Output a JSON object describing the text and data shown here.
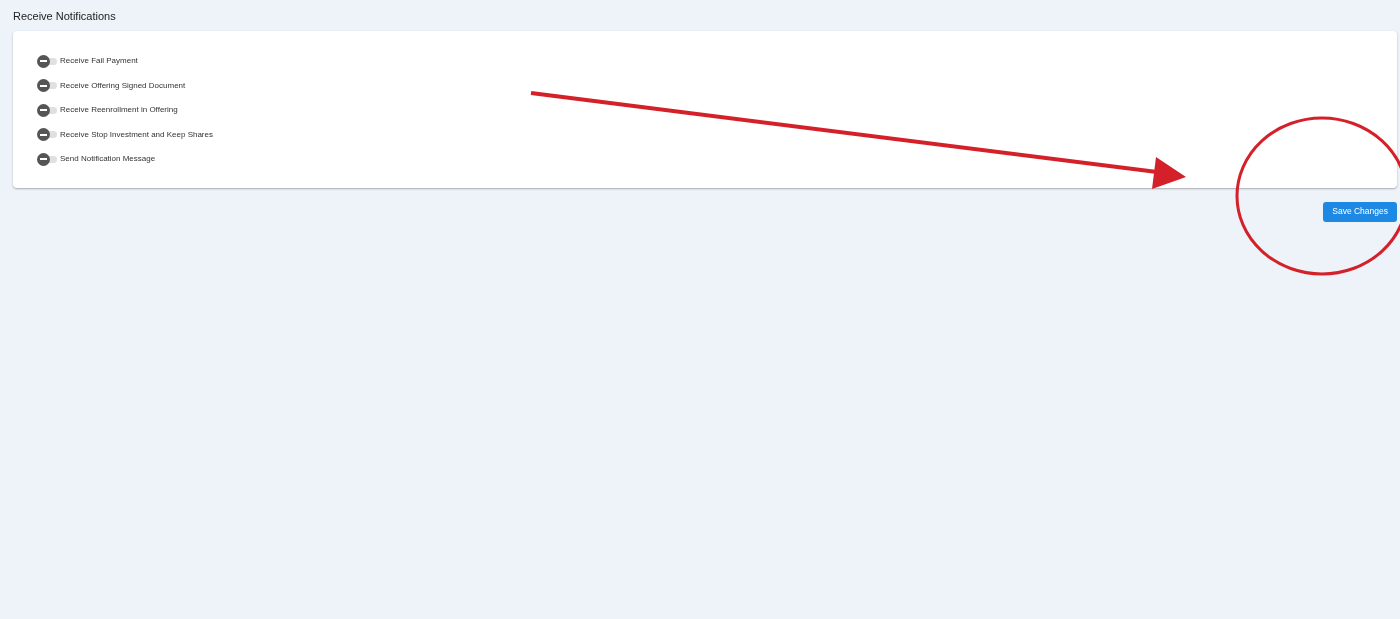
{
  "section": {
    "title": "Receive Notifications"
  },
  "toggles": [
    {
      "label": "Receive Fail Payment",
      "on": false
    },
    {
      "label": "Receive Offering Signed Document",
      "on": false
    },
    {
      "label": "Receive Reenrollment in Offering",
      "on": false
    },
    {
      "label": "Receive Stop Investment and Keep Shares",
      "on": false
    },
    {
      "label": "Send Notification Message",
      "on": false
    }
  ],
  "save_button": {
    "label": "Save Changes"
  }
}
